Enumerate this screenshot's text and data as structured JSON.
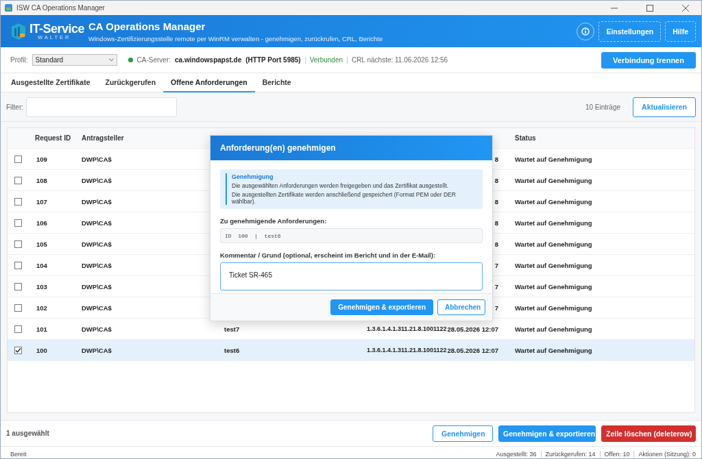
{
  "window": {
    "title": "ISW CA Operations Manager"
  },
  "header": {
    "logo_text": "IT-Service",
    "logo_subtext": "WALTER",
    "title": "CA Operations Manager",
    "subtitle": "Windows-Zertifizierungsstelle remote per WinRM verwalten - genehmigen, zurückrufen, CRL, Berichte",
    "buttons": [
      "Einstellungen",
      "Hilfe"
    ]
  },
  "connection": {
    "profile_label": "Profil:",
    "profile": "Standard",
    "connected": true,
    "server_label": "CA-Server:",
    "server": "ca.windowspapst.de",
    "port": "(HTTP Port 5985)",
    "state": "Verbunden",
    "crl": "CRL nächste: 11.06.2026 12:56",
    "disconnect_button": "Verbindung trennen"
  },
  "tabs": [
    {
      "label": "Ausgestellte Zertifikate",
      "selected": false
    },
    {
      "label": "Zurückgerufen",
      "selected": false
    },
    {
      "label": "Offene Anforderungen",
      "selected": true
    },
    {
      "label": "Berichte",
      "selected": false
    }
  ],
  "filter": {
    "label": "Filter:",
    "count": "10 Einträge",
    "refresh_button": "Aktualisieren"
  },
  "table": {
    "columns": [
      "Request ID",
      "Antragsteller",
      "Status"
    ],
    "rows": [
      {
        "id": "109",
        "requester": "DWP\\CA$",
        "date": "8",
        "status": "Wartet auf Genehmigung",
        "selected": false
      },
      {
        "id": "108",
        "requester": "DWP\\CA$",
        "date": "8",
        "status": "Wartet auf Genehmigung",
        "selected": false
      },
      {
        "id": "107",
        "requester": "DWP\\CA$",
        "date": "8",
        "status": "Wartet auf Genehmigung",
        "selected": false
      },
      {
        "id": "106",
        "requester": "DWP\\CA$",
        "date": "8",
        "status": "Wartet auf Genehmigung",
        "selected": false
      },
      {
        "id": "105",
        "requester": "DWP\\CA$",
        "date": "8",
        "status": "Wartet auf Genehmigung",
        "selected": false
      },
      {
        "id": "104",
        "requester": "DWP\\CA$",
        "date": "7",
        "status": "Wartet auf Genehmigung",
        "selected": false
      },
      {
        "id": "103",
        "requester": "DWP\\CA$",
        "date": "7",
        "status": "Wartet auf Genehmigung",
        "selected": false
      },
      {
        "id": "102",
        "requester": "DWP\\CA$",
        "date": "7",
        "status": "Wartet auf Genehmigung",
        "selected": false
      },
      {
        "id": "101",
        "requester": "DWP\\CA$",
        "name": "test7",
        "oid": "1.3.6.1.4.1.311.21.8.1001122",
        "date": "28.05.2026 12:07",
        "status": "Wartet auf Genehmigung",
        "selected": false
      },
      {
        "id": "100",
        "requester": "DWP\\CA$",
        "name": "test6",
        "oid": "1.3.6.1.4.1.311.21.8.1001122",
        "date": "28.05.2026 12:07",
        "status": "Wartet auf Genehmigung",
        "selected": true
      }
    ]
  },
  "dialog": {
    "title": "Anforderung(en) genehmigen",
    "info_title": "Genehmigung",
    "info_lines": [
      "Die ausgewählten Anforderungen werden freigegeben und das Zertifikat ausgestellt.",
      "Die ausgestellten Zertifikate werden anschließend gespeichert (Format PEM oder DER wählbar)."
    ],
    "requests_label": "Zu genehmigende Anforderungen:",
    "requests": "ID  100  |  test6",
    "comment_label": "Kommentar / Grund (optional, erscheint im Bericht und in der E-Mail):",
    "comment": "Ticket SR-465",
    "primary_button": "Genehmigen & exportieren",
    "cancel_button": "Abbrechen"
  },
  "footer": {
    "selection": "1 ausgewählt",
    "buttons": [
      {
        "label": "Genehmigen",
        "kind": "outline"
      },
      {
        "label": "Genehmigen & exportieren",
        "kind": "primary"
      },
      {
        "label": "Zeile löschen (deleterow)",
        "kind": "danger"
      }
    ]
  },
  "status_bar": {
    "text": "Bereit",
    "counters": [
      "Ausgestellt: 36",
      "Zurückgerufen: 14",
      "Offen: 10",
      "Aktionen (Sitzung): 0"
    ]
  }
}
